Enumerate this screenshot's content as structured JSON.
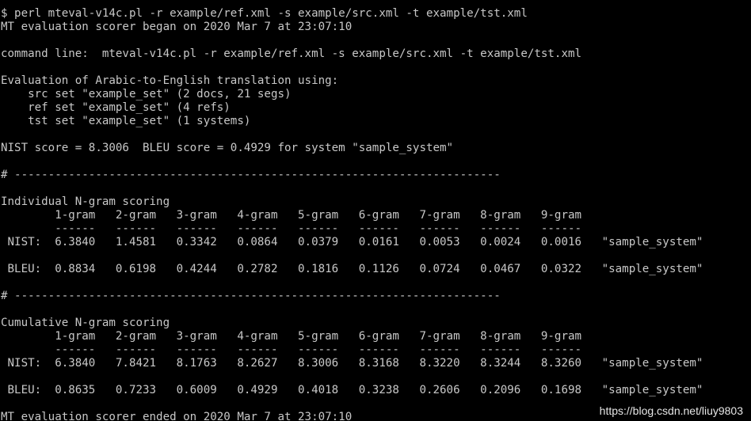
{
  "terminal": {
    "lines": [
      "",
      "$ perl mteval-v14c.pl -r example/ref.xml -s example/src.xml -t example/tst.xml",
      "MT evaluation scorer began on 2020 Mar 7 at 23:07:10",
      "",
      "command line:  mteval-v14c.pl -r example/ref.xml -s example/src.xml -t example/tst.xml",
      "",
      "Evaluation of Arabic-to-English translation using:",
      "    src set \"example_set\" (2 docs, 21 segs)",
      "    ref set \"example_set\" (4 refs)",
      "    tst set \"example_set\" (1 systems)",
      "",
      "NIST score = 8.3006  BLEU score = 0.4929 for system \"sample_system\"",
      "",
      "# ------------------------------------------------------------------------",
      "",
      "Individual N-gram scoring",
      "        1-gram   2-gram   3-gram   4-gram   5-gram   6-gram   7-gram   8-gram   9-gram",
      "        ------   ------   ------   ------   ------   ------   ------   ------   ------",
      " NIST:  6.3840   1.4581   0.3342   0.0864   0.0379   0.0161   0.0053   0.0024   0.0016   \"sample_system\"",
      "",
      " BLEU:  0.8834   0.6198   0.4244   0.2782   0.1816   0.1126   0.0724   0.0467   0.0322   \"sample_system\"",
      "",
      "# ------------------------------------------------------------------------",
      "",
      "Cumulative N-gram scoring",
      "        1-gram   2-gram   3-gram   4-gram   5-gram   6-gram   7-gram   8-gram   9-gram",
      "        ------   ------   ------   ------   ------   ------   ------   ------   ------",
      " NIST:  6.3840   7.8421   8.1763   8.2627   8.3006   8.3168   8.3220   8.3244   8.3260   \"sample_system\"",
      "",
      " BLEU:  0.8635   0.7233   0.6009   0.4929   0.4018   0.3238   0.2606   0.2096   0.1698   \"sample_system\"",
      "",
      "MT evaluation scorer ended on 2020 Mar 7 at 23:07:10"
    ],
    "watermark": "https://blog.csdn.net/liuy9803",
    "colors": {
      "background": "#000000",
      "text": "#c8c8c8"
    }
  }
}
